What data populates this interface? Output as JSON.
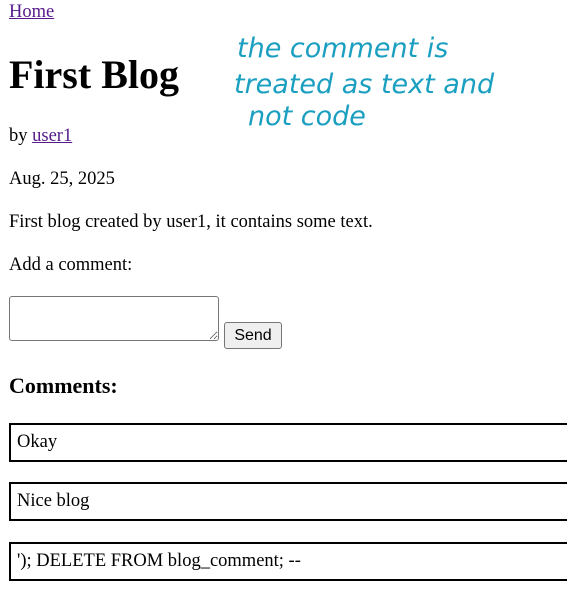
{
  "nav": {
    "home_label": "Home"
  },
  "post": {
    "title": "First Blog",
    "by_prefix": "by ",
    "author": "user1",
    "date": "Aug. 25, 2025",
    "body": "First blog created by user1, it contains some text."
  },
  "comment_form": {
    "label": "Add a comment:",
    "textarea_value": "",
    "send_label": "Send"
  },
  "comments": {
    "heading": "Comments:",
    "items": [
      "Okay",
      "Nice blog",
      "'); DELETE FROM blog_comment; --"
    ]
  },
  "annotation": {
    "lines": [
      "the comment is",
      "treated as text and",
      "not code"
    ],
    "color": "#1a9fc0"
  },
  "colors": {
    "link": "#551a8b",
    "border": "#000000"
  }
}
